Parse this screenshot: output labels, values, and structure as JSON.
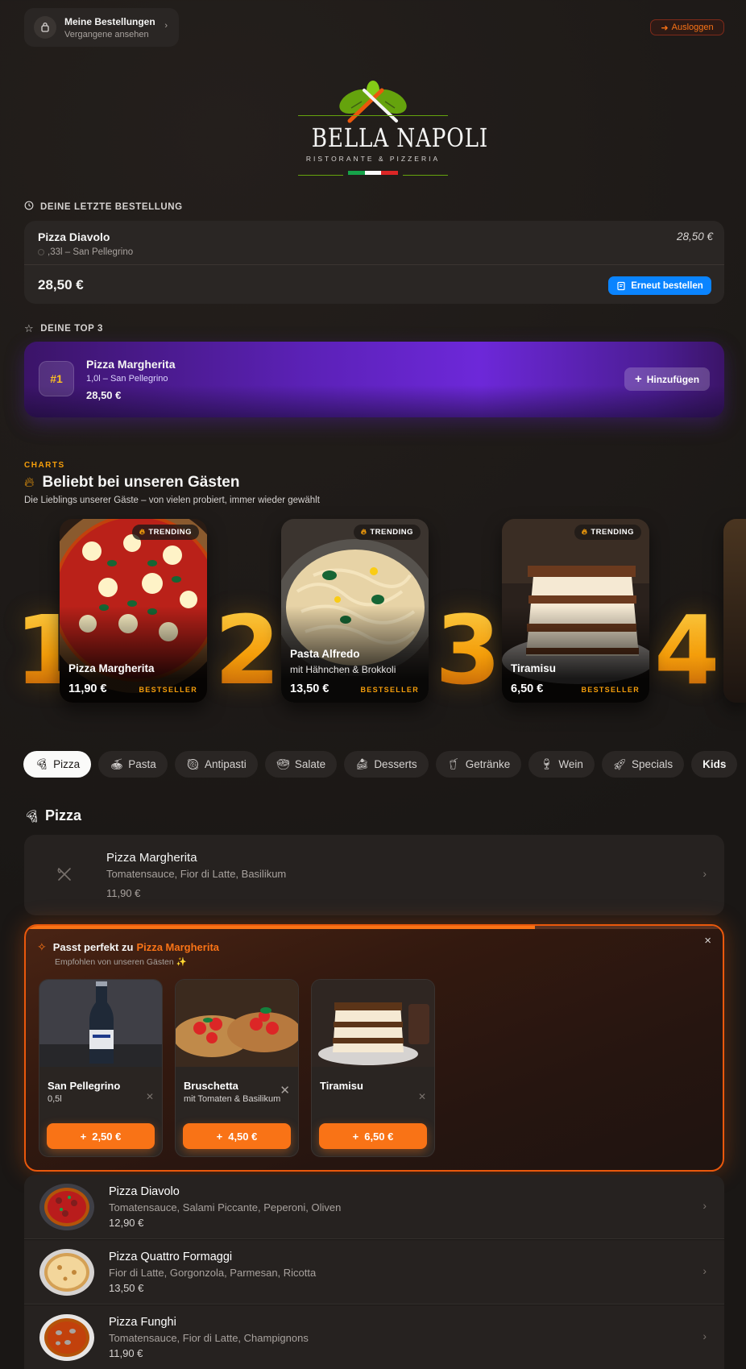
{
  "header": {
    "orders_title": "Meine Bestellungen",
    "orders_subtitle": "Vergangene ansehen",
    "logout_label": "Ausloggen"
  },
  "logo": {
    "name": "BELLA NAPOLI",
    "tagline": "RISTORANTE & PIZZERIA"
  },
  "last_order": {
    "section_label": "DEINE LETZTE BESTELLUNG",
    "item_name": "Pizza Diavolo",
    "item_detail": ",33l – San Pellegrino",
    "item_price": "28,50 €",
    "total": "28,50 €",
    "reorder_label": "Erneut bestellen"
  },
  "top3": {
    "section_label": "DEINE TOP 3",
    "rank": "#1",
    "name": "Pizza Margherita",
    "detail": "1,0l – San Pellegrino",
    "price": "28,50 €",
    "add_label": "Hinzufügen"
  },
  "charts": {
    "eyebrow": "CHARTS",
    "title": "Beliebt bei unseren Gästen",
    "subtitle": "Die Lieblings unserer Gäste – von vielen probiert, immer wieder gewählt",
    "trending_label": "TRENDING",
    "bestseller_label": "BESTSELLER",
    "items": [
      {
        "rank": "1",
        "name": "Pizza Margherita",
        "desc": "",
        "price": "11,90 €"
      },
      {
        "rank": "2",
        "name": "Pasta Alfredo",
        "desc": "mit Hähnchen & Brokkoli",
        "price": "13,50 €"
      },
      {
        "rank": "3",
        "name": "Tiramisu",
        "desc": "",
        "price": "6,50 €"
      },
      {
        "rank": "4",
        "name": "",
        "desc": "",
        "price": ""
      }
    ]
  },
  "categories": [
    "Pizza",
    "Pasta",
    "Antipasti",
    "Salate",
    "Desserts",
    "Getränke",
    "Wein",
    "Specials",
    "Kids"
  ],
  "menu": {
    "section_title": "Pizza",
    "featured": {
      "name": "Pizza Margherita",
      "desc": "Tomatensauce, Fior di Latte, Basilikum",
      "price": "11,90 €"
    },
    "reco": {
      "title_prefix": "Passt perfekt zu",
      "title_item": "Pizza Margherita",
      "subtitle": "Empfohlen von unseren Gästen ✨",
      "close": "×",
      "items": [
        {
          "name": "San Pellegrino",
          "desc": "0,5l",
          "price": "2,50 €"
        },
        {
          "name": "Bruschetta",
          "desc": "mit Tomaten & Basilikum",
          "price": "4,50 €"
        },
        {
          "name": "Tiramisu",
          "desc": "",
          "price": "6,50 €"
        }
      ]
    },
    "items": [
      {
        "name": "Pizza Diavolo",
        "desc": "Tomatensauce, Salami Piccante, Peperoni, Oliven",
        "price": "12,90 €"
      },
      {
        "name": "Pizza Quattro Formaggi",
        "desc": "Fior di Latte, Gorgonzola, Parmesan, Ricotta",
        "price": "13,50 €"
      },
      {
        "name": "Pizza Funghi",
        "desc": "Tomatensauce, Fior di Latte, Champignons",
        "price": "11,90 €"
      }
    ]
  },
  "colors": {
    "accent_orange": "#f97316",
    "accent_blue": "#0a84ff",
    "accent_purple": "#6d28d9",
    "gold": "#f59e0b"
  }
}
